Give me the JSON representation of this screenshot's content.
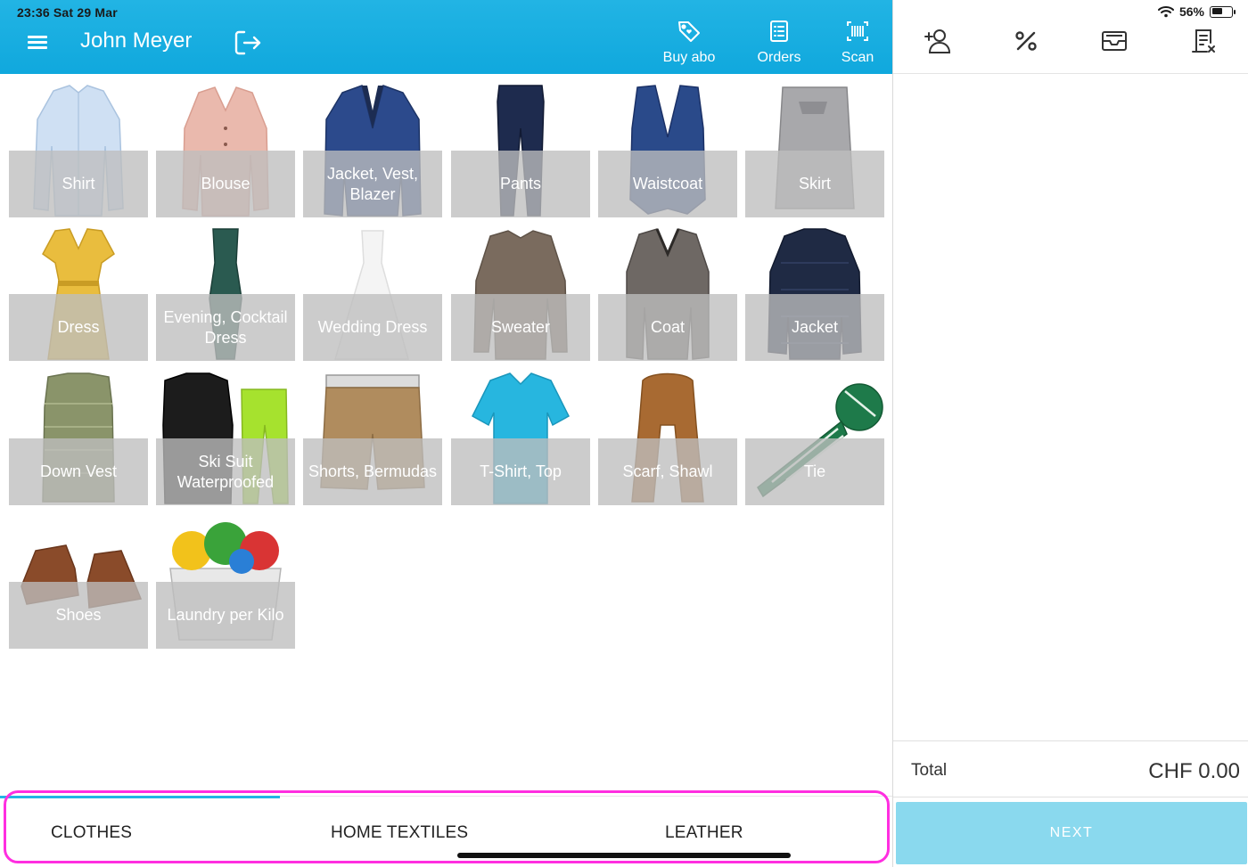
{
  "status_bar": {
    "time_date": "23:36   Sat 29 Mar",
    "battery_text": "56%",
    "battery_level": 0.56
  },
  "header": {
    "menu_icon": "hamburger-menu-icon",
    "user_name": "John Meyer",
    "logout_icon": "logout-icon",
    "actions": [
      {
        "label": "Buy abo",
        "icon": "tag-heart-icon"
      },
      {
        "label": "Orders",
        "icon": "list-document-icon"
      },
      {
        "label": "Scan",
        "icon": "barcode-icon"
      }
    ],
    "colors": {
      "bar": "#22b4e4",
      "text": "#ffffff"
    }
  },
  "items": [
    {
      "label": "Shirt"
    },
    {
      "label": "Blouse"
    },
    {
      "label": "Jacket, Vest, Blazer"
    },
    {
      "label": "Pants"
    },
    {
      "label": "Waistcoat"
    },
    {
      "label": "Skirt"
    },
    {
      "label": "Dress"
    },
    {
      "label": "Evening, Cocktail Dress"
    },
    {
      "label": "Wedding Dress"
    },
    {
      "label": "Sweater"
    },
    {
      "label": "Coat"
    },
    {
      "label": "Jacket"
    },
    {
      "label": "Down Vest"
    },
    {
      "label": "Ski Suit Waterproofed"
    },
    {
      "label": "Shorts, Bermudas"
    },
    {
      "label": "T-Shirt, Top"
    },
    {
      "label": "Scarf, Shawl"
    },
    {
      "label": "Tie"
    },
    {
      "label": "Shoes"
    },
    {
      "label": "Laundry per Kilo"
    }
  ],
  "tabs": [
    {
      "label": "CLOTHES",
      "active": true
    },
    {
      "label": "HOME TEXTILES",
      "active": false
    },
    {
      "label": "LEATHER",
      "active": false
    }
  ],
  "right_panel": {
    "toolbar_icons": [
      "add-customer-icon",
      "percent-icon",
      "inbox-tray-icon",
      "receipt-cancel-icon"
    ],
    "total_label": "Total",
    "total_value": "CHF 0.00",
    "next_label": "NEXT",
    "colors": {
      "next_button": "#8ad9ee"
    }
  }
}
